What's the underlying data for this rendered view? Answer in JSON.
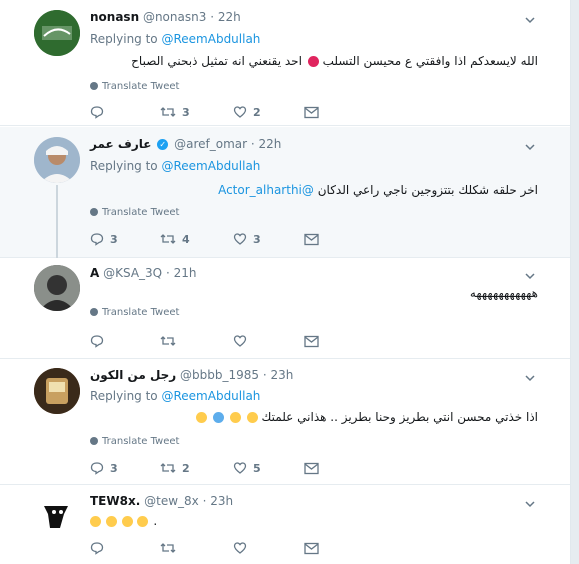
{
  "theme": {
    "link": "#1b95e0",
    "muted": "#657786",
    "border": "#e6ecf0",
    "highlight": "#f5f8fa",
    "verified": "#1da1f2",
    "heart_emoji": "#e0245e"
  },
  "tweets": [
    {
      "name": "nonasn",
      "handle": "@nonasn3",
      "time": "22h",
      "reply_label": "Replying to",
      "reply_to": "@ReemAbdullah",
      "text_before": "الله لايسعدكم اذا وافقتي ع محيسن التسلب",
      "emoji": "broken-heart-emoji",
      "text_after": "احد يقنعني انه تمثيل ذبحني الصباح",
      "translate": "Translate Tweet",
      "replies": "",
      "retweets": "3",
      "likes": "2"
    },
    {
      "name": "عارف عمر",
      "handle": "@aref_omar",
      "time": "22h",
      "reply_label": "Replying to",
      "reply_to": "@ReemAbdullah",
      "text": "اخر حلقه شكلك بتتزوجين ناجي راعي الدكان",
      "mention": "@Actor_alharthi",
      "translate": "Translate Tweet",
      "replies": "3",
      "retweets": "4",
      "likes": "3"
    },
    {
      "name": "A",
      "handle": "@KSA_3Q",
      "time": "21h",
      "text": "هههههههههههه",
      "translate": "Translate Tweet",
      "replies": "",
      "retweets": "",
      "likes": ""
    },
    {
      "name": "رجل من الكون",
      "handle": "@bbbb_1985",
      "time": "23h",
      "reply_label": "Replying to",
      "reply_to": "@ReemAbdullah",
      "text_line1": "اذا خذتي محسن انتي بطريز وحنا بطريز .. هذاني علمتك",
      "emojis_line2": [
        "laughing-emoji",
        "man-shrug-emoji",
        "hug-emoji",
        "joy-emoji"
      ],
      "translate": "Translate Tweet",
      "replies": "3",
      "retweets": "2",
      "likes": "5"
    },
    {
      "name": "TEW8x.",
      "handle": "@tew_8x",
      "time": "23h",
      "emojis": [
        "joy-emoji",
        "joy-emoji",
        "joy-emoji",
        "joy-emoji"
      ],
      "trailing": ".",
      "replies": "",
      "retweets": "",
      "likes": ""
    }
  ]
}
